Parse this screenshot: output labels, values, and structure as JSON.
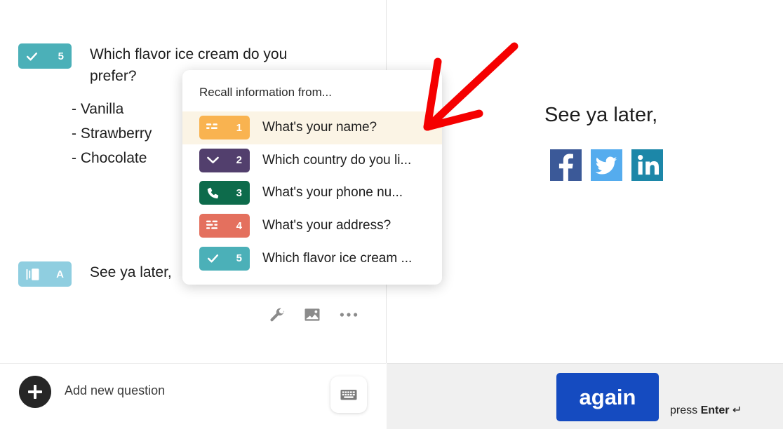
{
  "builder": {
    "question": {
      "badge": {
        "icon": "checkmark-icon",
        "number": "5",
        "color": "#4BB0B8"
      },
      "title": "Which flavor ice cream do you prefer?",
      "choices": [
        "-  Vanilla",
        "-  Strawberry",
        "-  Chocolate"
      ]
    },
    "ending": {
      "badge": {
        "icon": "statement-card-icon",
        "letter": "A",
        "color": "#8FCEE0"
      },
      "title": "See ya later,"
    },
    "toolbar": [
      {
        "name": "wrench-icon",
        "label": "Settings"
      },
      {
        "name": "image-icon",
        "label": "Add image"
      },
      {
        "name": "ellipsis-icon",
        "label": "More options"
      }
    ],
    "add_question_label": "Add new question",
    "keyboard_shortcut_label": "keyboard-icon"
  },
  "recall": {
    "title": "Recall information from...",
    "items": [
      {
        "number": "1",
        "icon": "short-text-icon",
        "color": "#F9B350",
        "label": "What's your name?",
        "active": true
      },
      {
        "number": "2",
        "icon": "dropdown-icon",
        "color": "#523F6D",
        "label": "Which country do you li...",
        "active": false
      },
      {
        "number": "3",
        "icon": "phone-icon",
        "color": "#0D6B4B",
        "label": "What's your phone nu...",
        "active": false
      },
      {
        "number": "4",
        "icon": "long-text-icon",
        "color": "#E4705E",
        "label": "What's your address?",
        "active": false
      },
      {
        "number": "5",
        "icon": "checkmark-icon",
        "color": "#4BB0B8",
        "label": "Which flavor ice cream ...",
        "active": false
      }
    ]
  },
  "preview": {
    "headline": "See ya later,",
    "social": [
      {
        "name": "facebook-icon",
        "color": "#3B5998"
      },
      {
        "name": "twitter-icon",
        "color": "#55ACEE"
      },
      {
        "name": "linkedin-icon",
        "color": "#1C87A8"
      }
    ]
  },
  "bottom_bar": {
    "submit_label": "again",
    "hint_prefix": "press ",
    "hint_key": "Enter",
    "hint_suffix": " ↵",
    "submit_color": "#154BC0"
  },
  "annotation": {
    "arrow": "red-arrow-icon",
    "color": "#F50000"
  }
}
